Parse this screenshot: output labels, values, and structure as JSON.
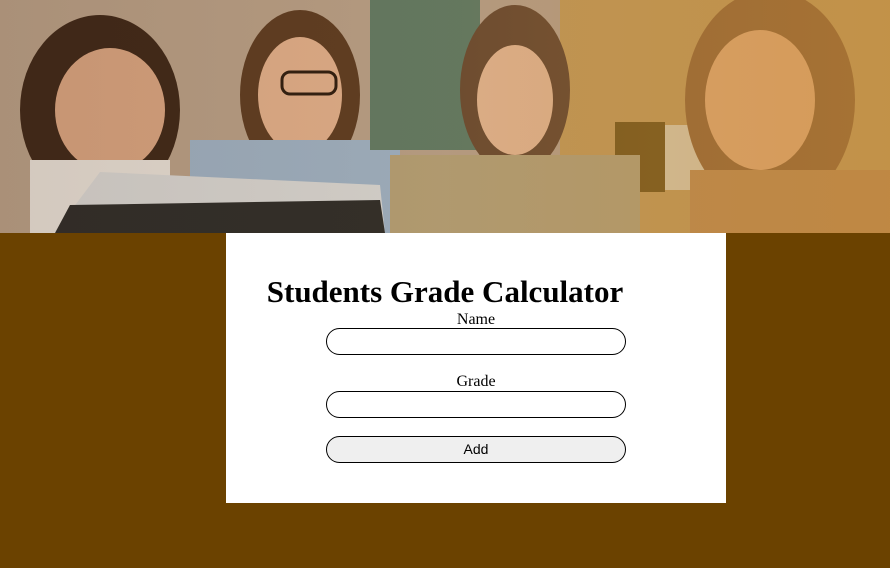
{
  "colors": {
    "page_background": "#6b4200",
    "card_background": "#ffffff",
    "button_background": "#efefef"
  },
  "hero": {
    "image": "students-at-laptop-photo"
  },
  "form": {
    "title": "Students Grade Calculator",
    "name_label": "Name",
    "name_value": "",
    "grade_label": "Grade",
    "grade_value": "",
    "add_label": "Add"
  }
}
